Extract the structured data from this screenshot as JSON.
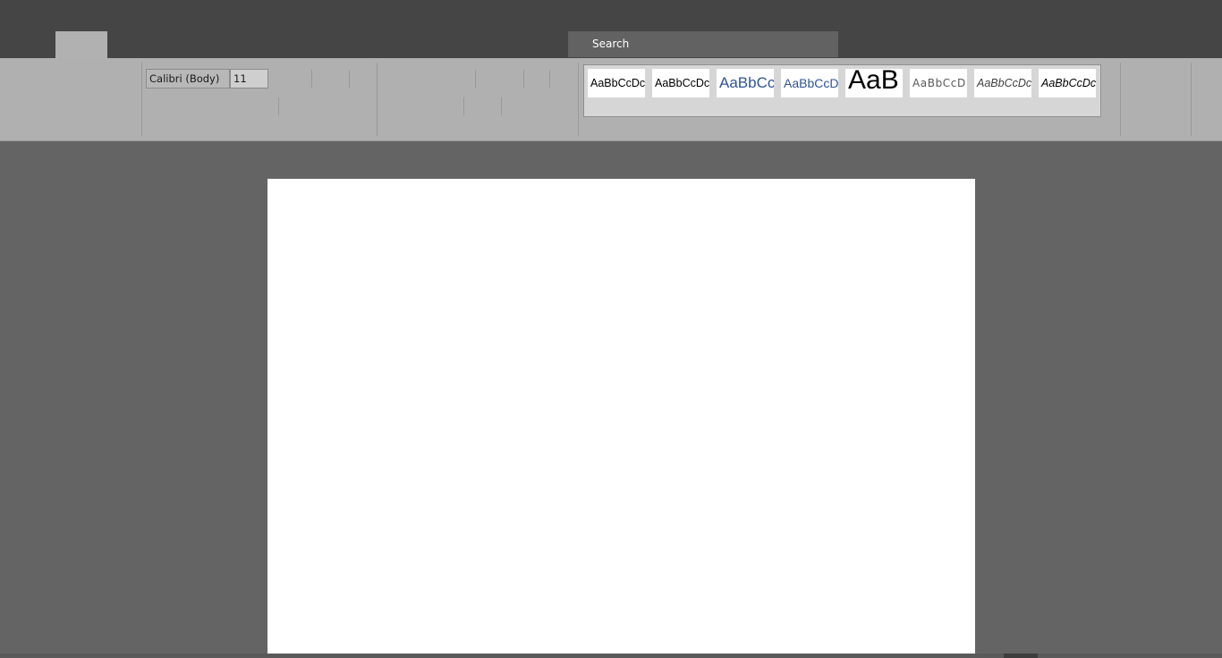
{
  "titlebar": {
    "search": {
      "label": "Search"
    }
  },
  "ribbon": {
    "font": {
      "name": "Calibri (Body)",
      "size": "11"
    },
    "styles": [
      {
        "preview": "AaBbCcDc",
        "color": "#000000"
      },
      {
        "preview": "AaBbCcDc",
        "color": "#000000"
      },
      {
        "preview": "AaBbCc",
        "color": "#2f5496"
      },
      {
        "preview": "AaBbCcD",
        "color": "#2f5496"
      },
      {
        "preview": "AaB",
        "color": "#000000"
      },
      {
        "preview": "AaBbCcD",
        "color": "#595959"
      },
      {
        "preview": "AaBbCcDc",
        "color": "#404040"
      },
      {
        "preview": "AaBbCcDc",
        "color": "#000000"
      }
    ]
  },
  "colors": {
    "titlebar": "#454545",
    "ribbon": "#b0b0b0",
    "workspace": "#646464",
    "page": "#ffffff"
  }
}
